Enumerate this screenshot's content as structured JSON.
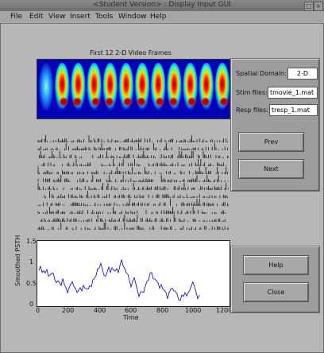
{
  "window": {
    "title": "<Student Version> : Display Input GUI",
    "controls": [
      "×",
      "□"
    ]
  },
  "menu": [
    "File",
    "Edit",
    "View",
    "Insert",
    "Tools",
    "Window",
    "Help"
  ],
  "frames": {
    "title": "First 12 2-D Video Frames",
    "count": 12
  },
  "raster": {
    "rows": 12
  },
  "psth": {
    "ylabel": "Smoothed PSTH",
    "xlabel": "Time",
    "xticks": [
      "0",
      "200",
      "400",
      "600",
      "800",
      "1000",
      "1200"
    ],
    "yticks": [
      "1.5",
      "1",
      "0.5",
      "0"
    ]
  },
  "controls": {
    "spatial_domain_label": "Spatial Domain:",
    "spatial_domain_value": "2-D",
    "stim_files_label": "Stim files:",
    "stim_files_value": "tmovie_1.mat",
    "resp_files_label": "Resp files:",
    "resp_files_value": "tresp_1.mat",
    "prev_label": "Prev",
    "next_label": "Next",
    "help_label": "Help",
    "close_label": "Close"
  },
  "colors": {
    "window_bg": "#b7b7b7",
    "panel_bg": "#9c9c9c",
    "frame_bg": "#0000b4",
    "psth_line": "#0000cc"
  }
}
